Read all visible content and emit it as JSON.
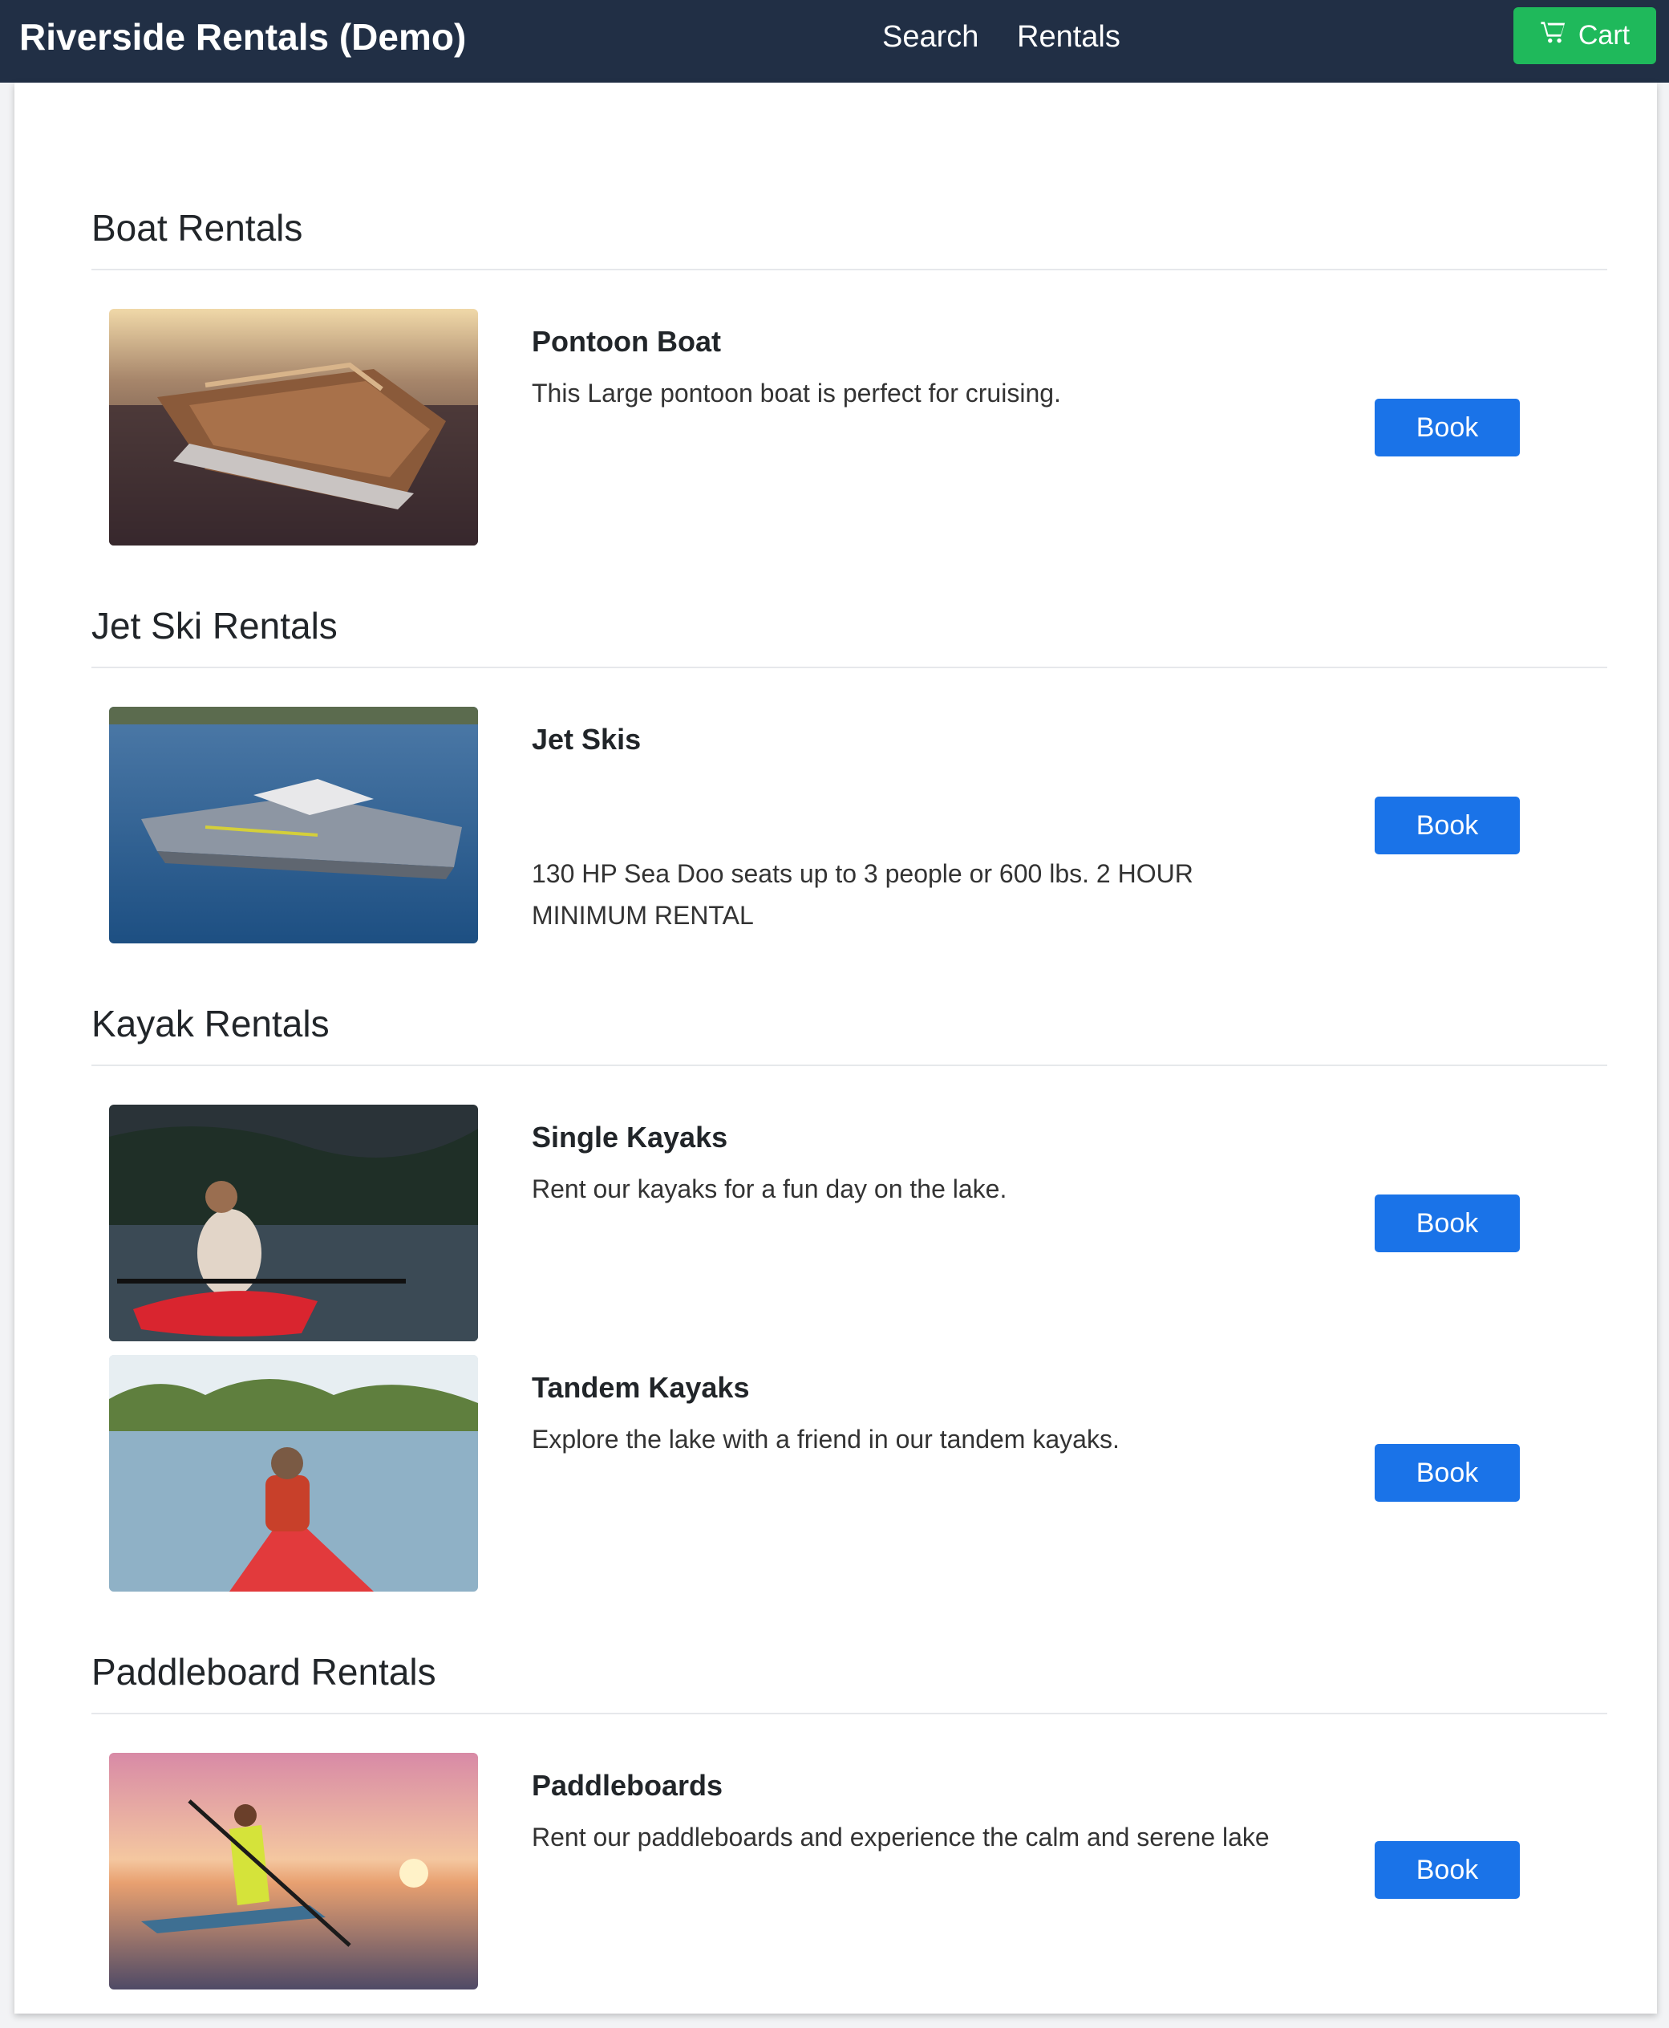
{
  "navbar": {
    "brand": "Riverside Rentals (Demo)",
    "links": [
      "Search",
      "Rentals"
    ],
    "cart_label": "Cart",
    "cart_icon": "shopping-cart-icon",
    "background": "#212f45",
    "cart_color": "#1fb95b"
  },
  "sections": [
    {
      "title": "Boat Rentals",
      "items": [
        {
          "title": "Pontoon Boat",
          "description": "This Large pontoon boat is perfect for cruising.",
          "button": "Book",
          "image": "pontoon-boat-photo"
        }
      ]
    },
    {
      "title": "Jet Ski Rentals",
      "items": [
        {
          "title": "Jet Skis",
          "description": "130 HP Sea Doo seats up to 3 people or 600 lbs. 2 HOUR MINIMUM RENTAL",
          "button": "Book",
          "image": "jet-ski-photo"
        }
      ]
    },
    {
      "title": "Kayak Rentals",
      "items": [
        {
          "title": "Single Kayaks",
          "description": "Rent our kayaks for a fun day on the lake.",
          "button": "Book",
          "image": "single-kayak-photo"
        },
        {
          "title": "Tandem Kayaks",
          "description": "Explore the lake with a friend in our tandem kayaks.",
          "button": "Book",
          "image": "tandem-kayak-photo"
        }
      ]
    },
    {
      "title": "Paddleboard Rentals",
      "items": [
        {
          "title": "Paddleboards",
          "description": "Rent our paddleboards and experience the calm and serene lake",
          "button": "Book",
          "image": "paddleboard-photo"
        }
      ]
    }
  ],
  "colors": {
    "book_button": "#1a73e8"
  }
}
